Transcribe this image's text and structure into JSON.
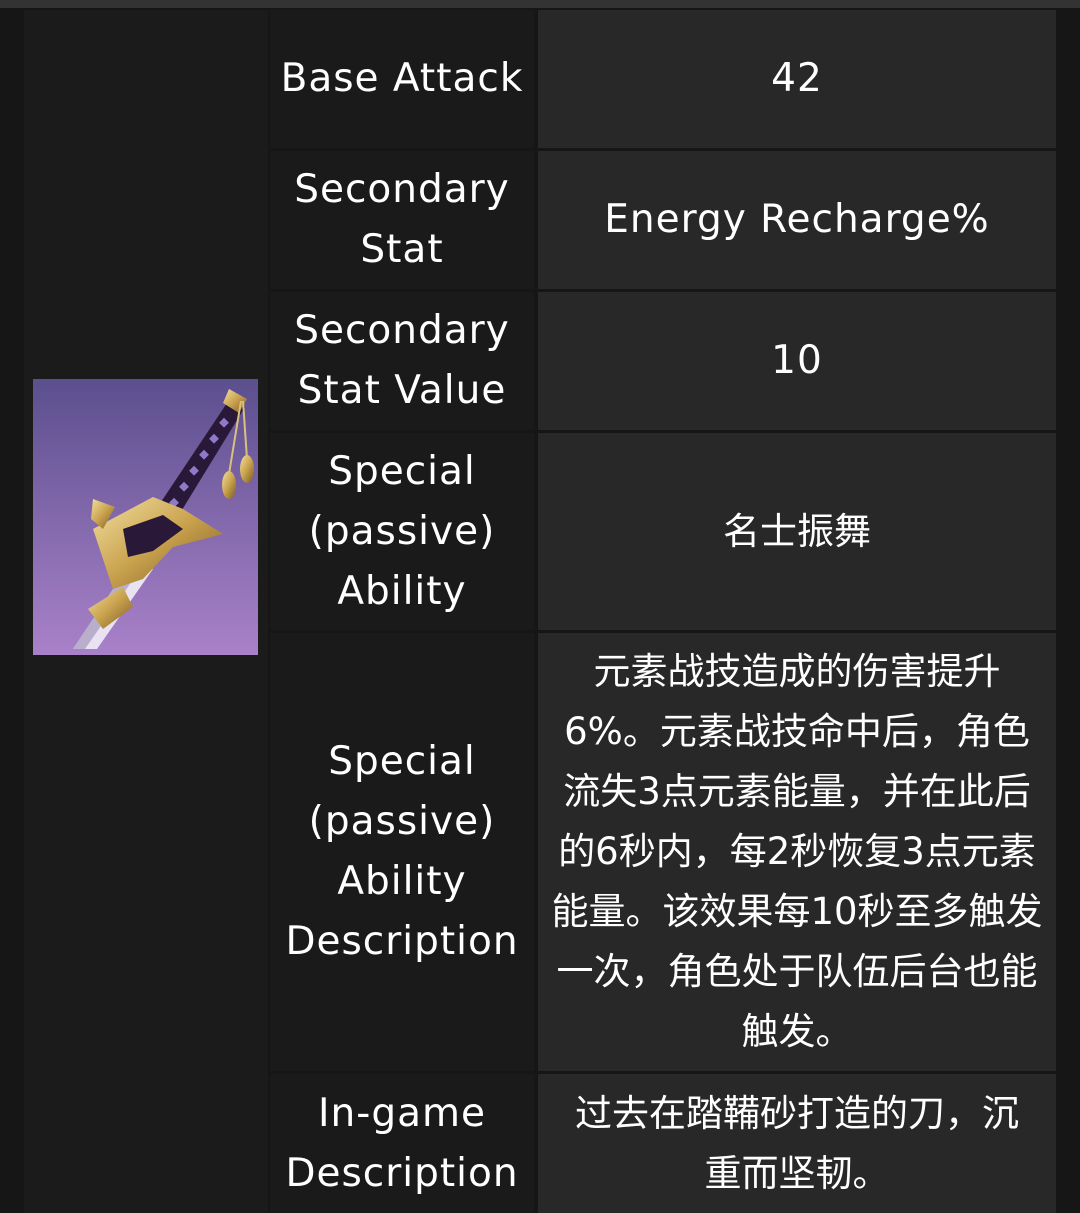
{
  "rows": [
    {
      "label": "Base Attack",
      "value": "42"
    },
    {
      "label": "Secondary Stat",
      "value": "Energy Recharge%"
    },
    {
      "label": "Secondary Stat Value",
      "value": "10"
    },
    {
      "label": "Special (passive) Ability",
      "value": "名士振舞"
    },
    {
      "label": "Special (passive) Ability Description",
      "value": "元素战技造成的伤害提升6%。元素战技命中后，角色流失3点元素能量，并在此后的6秒内，每2秒恢复3点元素能量。该效果每10秒至多触发一次，角色处于队伍后台也能触发。"
    },
    {
      "label": "In-game Description",
      "value": "过去在踏鞴砂打造的刀，沉重而坚韧。"
    }
  ],
  "image": {
    "icon": "sword-icon",
    "bg_top": "#5b4f8e",
    "bg_bottom": "#a981c9"
  }
}
